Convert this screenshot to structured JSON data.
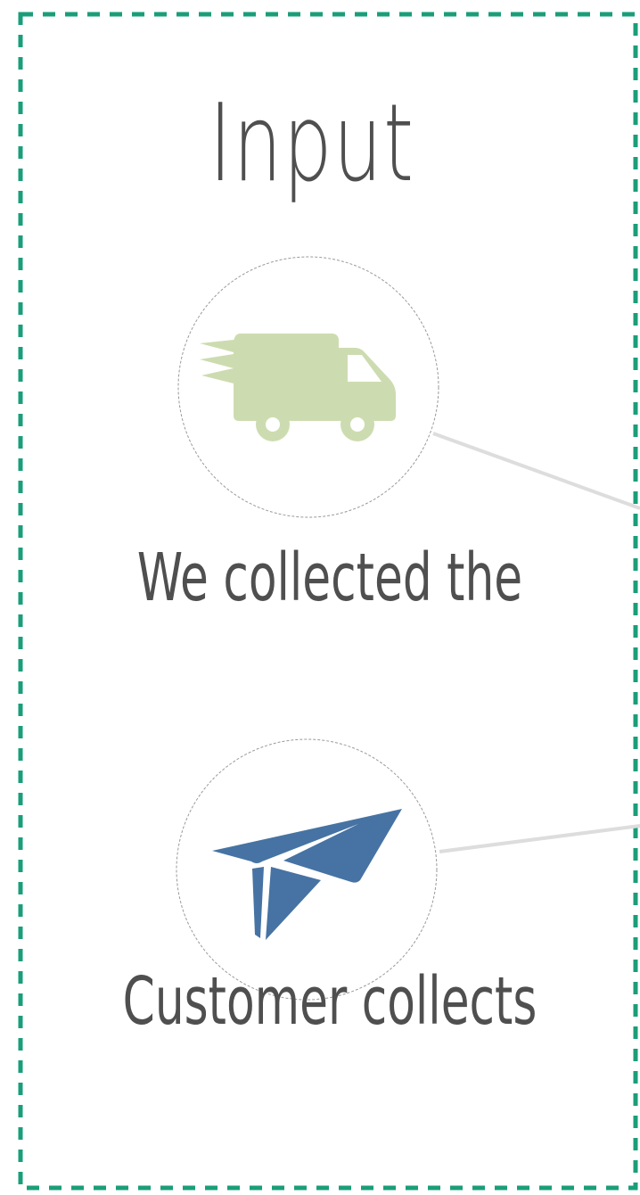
{
  "section": {
    "title": "Input",
    "border_color": "#1a9e7a"
  },
  "nodes": [
    {
      "icon": "delivery-truck-icon",
      "caption": "We collected the",
      "icon_color": "#cddcb0"
    },
    {
      "icon": "paper-plane-icon",
      "caption": "Customer collects",
      "icon_color": "#4673a3"
    }
  ],
  "connector_color": "#dddddd",
  "circle_border_color": "#9a9a9a"
}
